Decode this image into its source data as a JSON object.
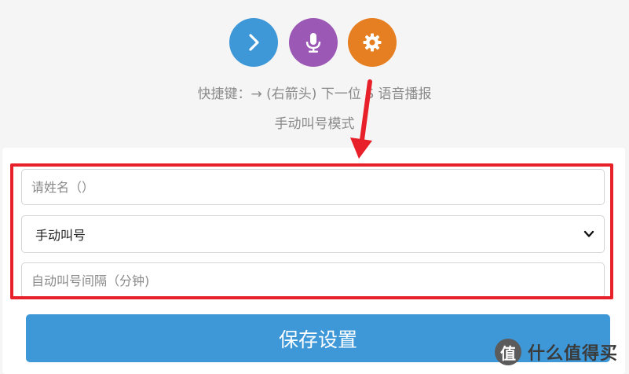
{
  "toolbar": {
    "buttons": [
      {
        "icon": "chevron-right-icon",
        "color": "#3e98d8"
      },
      {
        "icon": "microphone-icon",
        "color": "#9b58b5"
      },
      {
        "icon": "gear-icon",
        "color": "#e67e22"
      }
    ]
  },
  "hints": {
    "shortcut": "快捷键：→ (右箭头) 下一位  S 语音播报",
    "mode": "手动叫号模式"
  },
  "form": {
    "name_placeholder": "请姓名（）",
    "call_mode_value": "手动叫号",
    "interval_placeholder": "自动叫号间隔（分钟)",
    "save_label": "保存设置"
  },
  "annotation": {
    "highlight_color": "#e8202a"
  },
  "watermark": {
    "logo_glyph": "值",
    "text": "什么值得买"
  }
}
